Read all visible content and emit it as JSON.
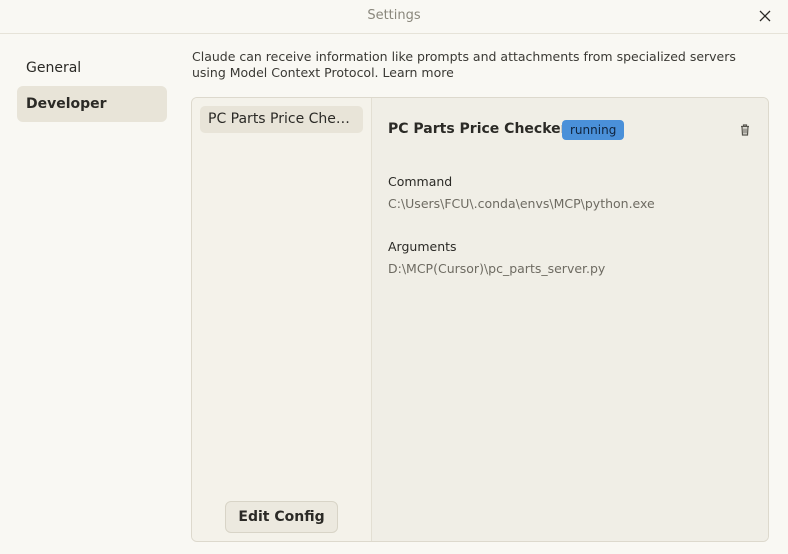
{
  "window": {
    "title": "Settings"
  },
  "nav": {
    "items": [
      {
        "label": "General",
        "selected": false
      },
      {
        "label": "Developer",
        "selected": true
      }
    ]
  },
  "intro": {
    "text": "Claude can receive information like prompts and attachments from specialized servers using Model Context Protocol.",
    "link": "Learn more"
  },
  "servers": {
    "items": [
      {
        "label": "PC Parts Price Checker",
        "selected": true
      }
    ],
    "edit_config_label": "Edit Config"
  },
  "detail": {
    "name": "PC Parts Price Checker",
    "status": "running",
    "status_color": "#4a90d9",
    "command_label": "Command",
    "command_value": "C:\\Users\\FCU\\.conda\\envs\\MCP\\python.exe",
    "arguments_label": "Arguments",
    "arguments_value": "D:\\MCP(Cursor)\\pc_parts_server.py",
    "delete_icon": "trash-icon"
  },
  "icons": {
    "close": "close-icon"
  }
}
